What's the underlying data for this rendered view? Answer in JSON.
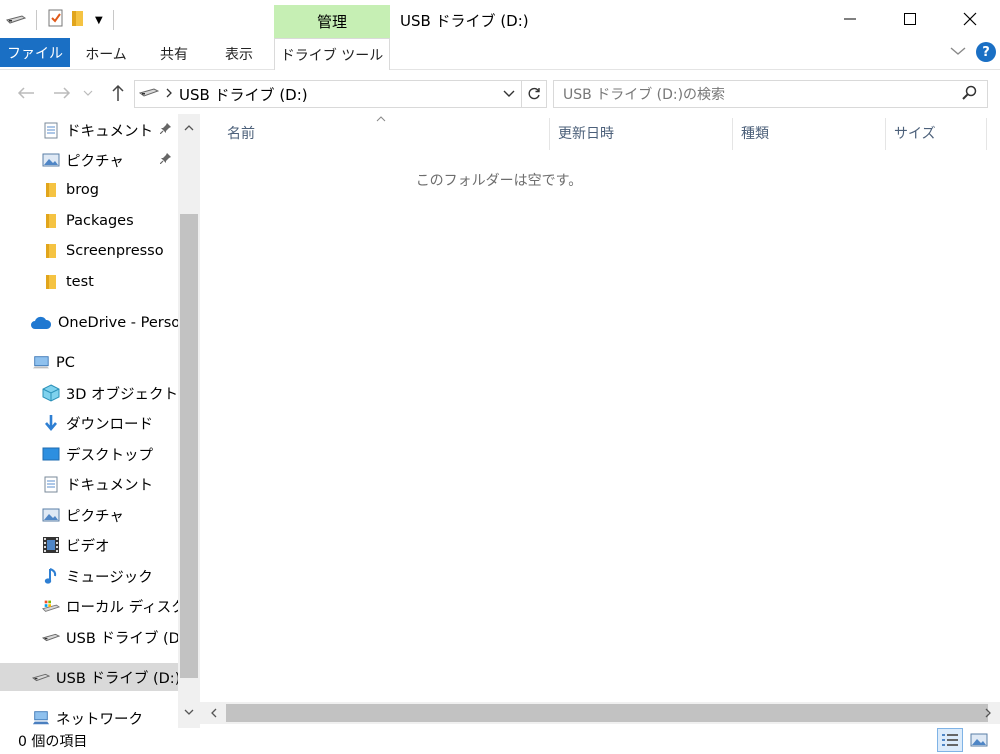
{
  "titlebar": {
    "manage_tab": "管理",
    "window_title": "USB ドライブ (D:)"
  },
  "ribbon": {
    "tabs": [
      "ファイル",
      "ホーム",
      "共有",
      "表示",
      "ドライブ ツール"
    ],
    "help_label": "?"
  },
  "address": {
    "path": "USB ドライブ (D:)",
    "search_placeholder": "USB ドライブ (D:)の検索"
  },
  "nav": {
    "items": [
      {
        "label": "ドキュメント",
        "icon": "document-icon",
        "pinned": true
      },
      {
        "label": "ピクチャ",
        "icon": "picture-icon",
        "pinned": true
      },
      {
        "label": "brog",
        "icon": "folder-icon"
      },
      {
        "label": "Packages",
        "icon": "folder-icon"
      },
      {
        "label": "Screenpresso",
        "icon": "folder-icon"
      },
      {
        "label": "test",
        "icon": "folder-icon"
      },
      {
        "label": "OneDrive - Person",
        "icon": "onedrive-icon"
      },
      {
        "label": "PC",
        "icon": "pc-icon"
      },
      {
        "label": "3D オブジェクト",
        "icon": "3d-objects-icon"
      },
      {
        "label": "ダウンロード",
        "icon": "download-icon"
      },
      {
        "label": "デスクトップ",
        "icon": "desktop-icon"
      },
      {
        "label": "ドキュメント",
        "icon": "document-icon"
      },
      {
        "label": "ピクチャ",
        "icon": "picture-icon"
      },
      {
        "label": "ビデオ",
        "icon": "video-icon"
      },
      {
        "label": "ミュージック",
        "icon": "music-icon"
      },
      {
        "label": "ローカル ディスク (C",
        "icon": "local-disk-icon"
      },
      {
        "label": "USB ドライブ (D:)",
        "icon": "usb-drive-icon"
      },
      {
        "label": "USB ドライブ (D:)",
        "icon": "usb-drive-icon",
        "selected": true
      },
      {
        "label": "ネットワーク",
        "icon": "network-icon"
      }
    ]
  },
  "content": {
    "columns": [
      "名前",
      "更新日時",
      "種類",
      "サイズ"
    ],
    "empty_message": "このフォルダーは空です。"
  },
  "status": {
    "item_count": "0 個の項目"
  },
  "colors": {
    "file_tab": "#1a6fc4",
    "manage_tab": "#c6efb4",
    "selection": "#d9d9d9"
  }
}
